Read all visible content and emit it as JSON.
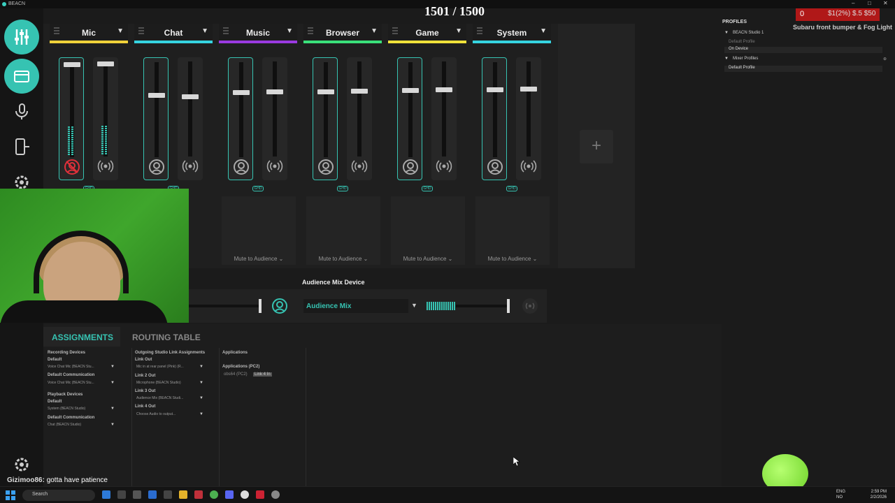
{
  "window": {
    "title": "BEACN",
    "minimize": "–",
    "maximize": "□",
    "close": "✕"
  },
  "stream_counter": "1501 / 1500",
  "channels": [
    {
      "name": "Mic",
      "color": "#f0d23a"
    },
    {
      "name": "Chat",
      "color": "#36d4e0"
    },
    {
      "name": "Music",
      "color": "#9a3ae0"
    },
    {
      "name": "Browser",
      "color": "#3ae07a"
    },
    {
      "name": "Game",
      "color": "#f0e23a"
    },
    {
      "name": "System",
      "color": "#36d4e0"
    }
  ],
  "ghd_label": "GHD",
  "mute_to_audience": "Mute to Audience",
  "add_button": "+",
  "audience": {
    "label": "Audience Mix Device",
    "selected": "Audience Mix"
  },
  "tabs": {
    "assignments": "ASSIGNMENTS",
    "routing": "ROUTING TABLE"
  },
  "assignments": {
    "recording_devices": "Recording Devices",
    "default": "Default",
    "default_value": "Voice Chat Mic (BEACN Stu...",
    "default_communication": "Default Communication",
    "default_communication_value": "Voice Chat Mic (BEACN Stu...",
    "playback_devices": "Playback Devices",
    "playback_default": "Default",
    "playback_default_value": "System (BEACN Studio)",
    "playback_communication": "Default Communication",
    "playback_communication_value": "Chat (BEACN Studio)",
    "outgoing": "Outgoing Studio Link Assignments",
    "link1": "Link Out",
    "link1_value": "Mic in at rear panel (Pink) (R...",
    "link2": "Link 2 Out",
    "link2_value": "Microphone (BEACN Studio)",
    "link3": "Link 3 Out",
    "link3_value": "Audience Mix (BEACN Studi...",
    "link4": "Link 4 Out",
    "link4_value": "Choose Audio to output...",
    "applications": "Applications",
    "applications_pc2": "Applications (PC2)",
    "obs_app": "obs64 (PC2)",
    "obs_link": "Link 4 In"
  },
  "profiles": {
    "title": "PROFILES",
    "studio": "BEACN Studio 1",
    "default_profile": "Default Profile",
    "on_device": "On Device",
    "mixer_profiles": "Mixer Profiles",
    "mixer_default": "Default Profile"
  },
  "overlay": {
    "counter": "0",
    "counter_text": "$1(2%) $.5 $50",
    "subaru": "Subaru front bumper & Fog Light"
  },
  "chat": {
    "user": "Gizimoo86:",
    "message": "gotta have patience"
  },
  "taskbar": {
    "search": "Search",
    "lang1": "ENG",
    "lang2": "NO",
    "time": "2:59 PM",
    "date": "2/2/2026"
  }
}
